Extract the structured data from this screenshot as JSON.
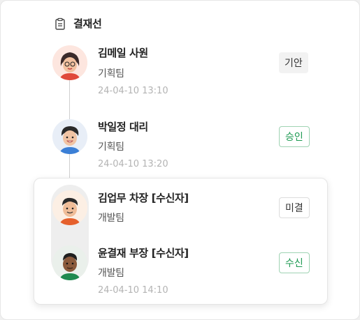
{
  "header": {
    "title": "결재선",
    "icon": "clipboard-icon"
  },
  "approvers": [
    {
      "name": "김메일 사원",
      "dept": "기획팀",
      "time": "24-04-10 13:10",
      "status": "기안",
      "status_style": "gray",
      "avatar": "woman-glasses"
    },
    {
      "name": "박일정 대리",
      "dept": "기획팀",
      "time": "24-04-10 13:20",
      "status": "승인",
      "status_style": "green",
      "avatar": "man-smile"
    }
  ],
  "receivers": [
    {
      "name": "김업무 차장 [수신자]",
      "dept": "개발팀",
      "time": "",
      "status": "미결",
      "status_style": "gray-outline",
      "avatar": "man-orange"
    },
    {
      "name": "윤결재 부장 [수신자]",
      "dept": "개발팀",
      "time": "24-04-10 14:10",
      "status": "수신",
      "status_style": "green",
      "avatar": "man-dark"
    }
  ],
  "colors": {
    "accent_green": "#1d9a52",
    "timeline": "#cfcfcf"
  }
}
